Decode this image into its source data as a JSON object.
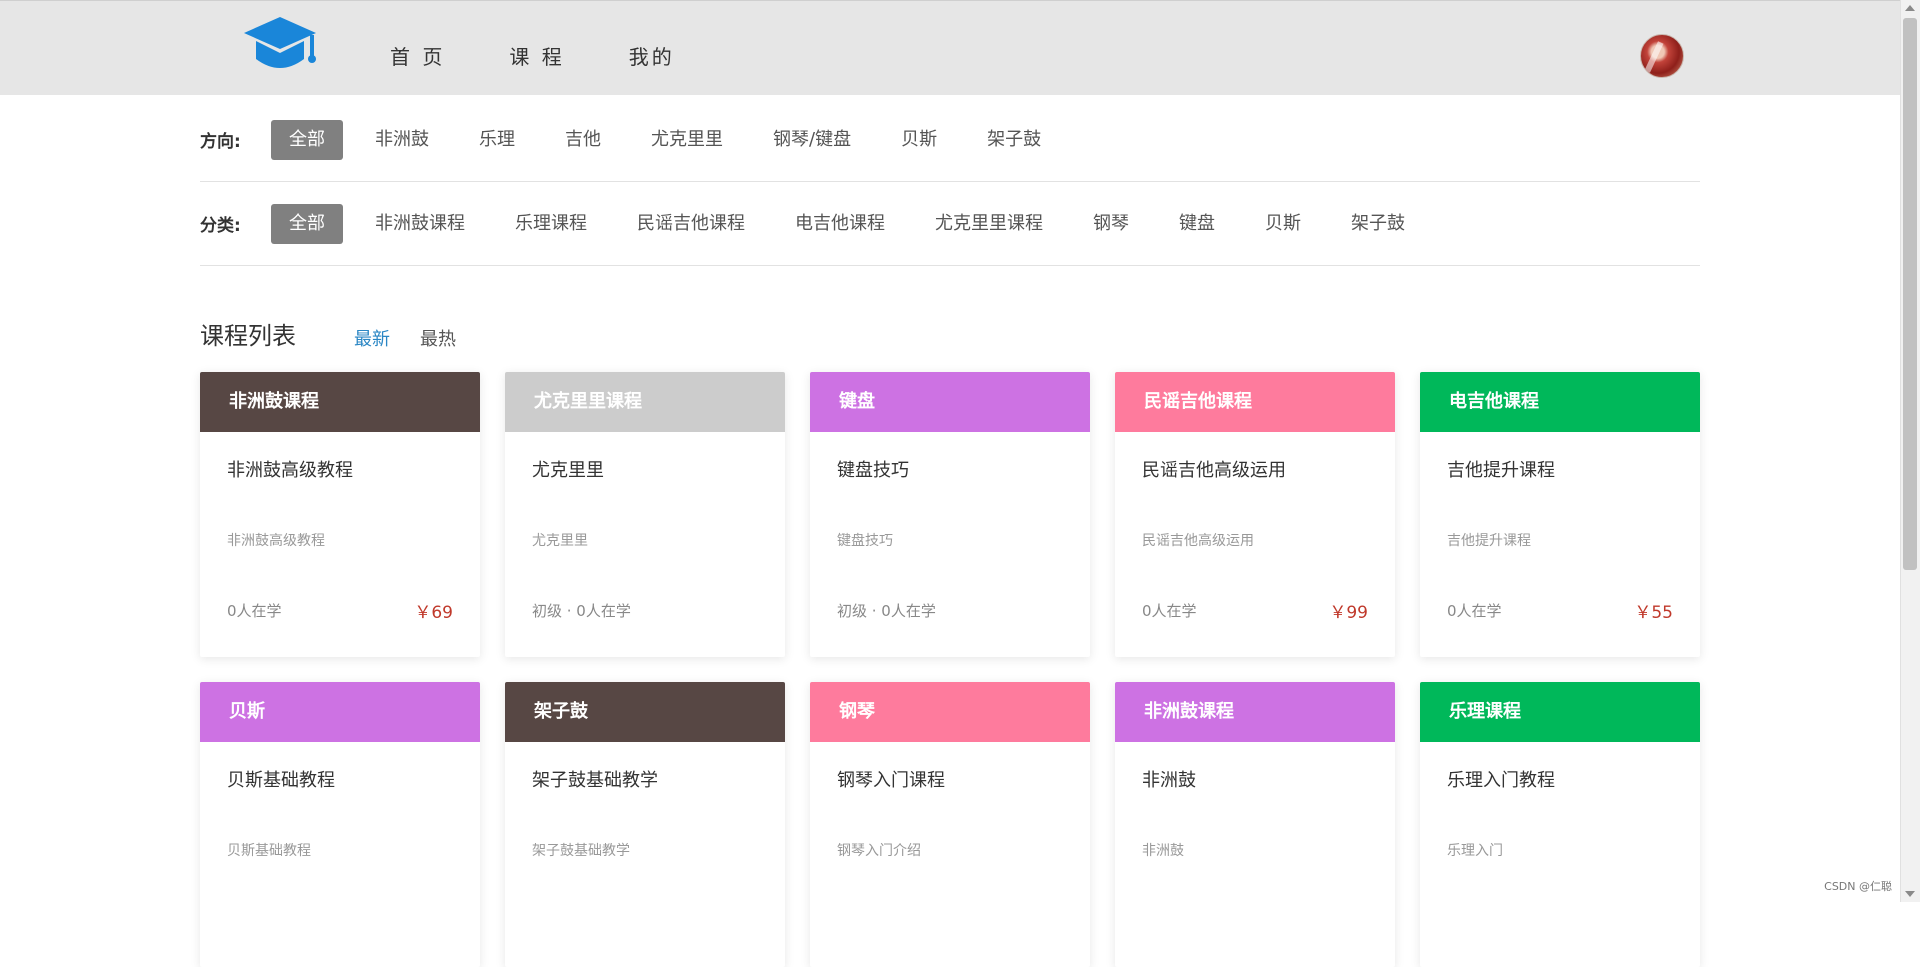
{
  "nav": {
    "items": [
      {
        "label": "首 页"
      },
      {
        "label": "课 程"
      },
      {
        "label": "我的"
      }
    ]
  },
  "filters": {
    "direction": {
      "label": "方向:",
      "options": [
        "全部",
        "非洲鼓",
        "乐理",
        "吉他",
        "尤克里里",
        "钢琴/键盘",
        "贝斯",
        "架子鼓"
      ],
      "selected": "全部"
    },
    "category": {
      "label": "分类:",
      "options": [
        "全部",
        "非洲鼓课程",
        "乐理课程",
        "民谣吉他课程",
        "电吉他课程",
        "尤克里里课程",
        "钢琴",
        "键盘",
        "贝斯",
        "架子鼓"
      ],
      "selected": "全部"
    }
  },
  "course_list": {
    "title": "课程列表",
    "sort_options": [
      {
        "label": "最新",
        "active": true
      },
      {
        "label": "最热",
        "active": false
      }
    ]
  },
  "courses": [
    {
      "category": "非洲鼓课程",
      "color": "#574744",
      "title": "非洲鼓高级教程",
      "desc": "非洲鼓高级教程",
      "meta": "0人在学",
      "price": "￥69"
    },
    {
      "category": "尤克里里课程",
      "color": "#cccccc",
      "title": "尤克里里",
      "desc": "尤克里里",
      "meta": "初级  · 0人在学",
      "price": ""
    },
    {
      "category": "键盘",
      "color": "#cd72e3",
      "title": "键盘技巧",
      "desc": "键盘技巧",
      "meta": "初级  · 0人在学",
      "price": ""
    },
    {
      "category": "民谣吉他课程",
      "color": "#fe7b9d",
      "title": "民谣吉他高级运用",
      "desc": "民谣吉他高级运用",
      "meta": "0人在学",
      "price": "￥99"
    },
    {
      "category": "电吉他课程",
      "color": "#00b85a",
      "title": "吉他提升课程",
      "desc": "吉他提升课程",
      "meta": "0人在学",
      "price": "￥55"
    },
    {
      "category": "贝斯",
      "color": "#cd72e3",
      "title": "贝斯基础教程",
      "desc": "贝斯基础教程",
      "meta": "",
      "price": ""
    },
    {
      "category": "架子鼓",
      "color": "#574744",
      "title": "架子鼓基础教学",
      "desc": "架子鼓基础教学",
      "meta": "",
      "price": ""
    },
    {
      "category": "钢琴",
      "color": "#fe7b9d",
      "title": "钢琴入门课程",
      "desc": "钢琴入门介绍",
      "meta": "",
      "price": ""
    },
    {
      "category": "非洲鼓课程",
      "color": "#cd72e3",
      "title": "非洲鼓",
      "desc": "非洲鼓",
      "meta": "",
      "price": ""
    },
    {
      "category": "乐理课程",
      "color": "#00b85a",
      "title": "乐理入门教程",
      "desc": "乐理入门",
      "meta": "",
      "price": ""
    }
  ],
  "icons": {
    "logo": "graduation-cap-icon",
    "avatar": "user-avatar"
  },
  "colors": {
    "header_bg": "#e6e6e6",
    "active_filter": "#808080",
    "active_sort": "#2a86c4",
    "price": "#c0392b",
    "logo_blue": "#1a86d9"
  },
  "watermark": "CSDN @仁聪"
}
